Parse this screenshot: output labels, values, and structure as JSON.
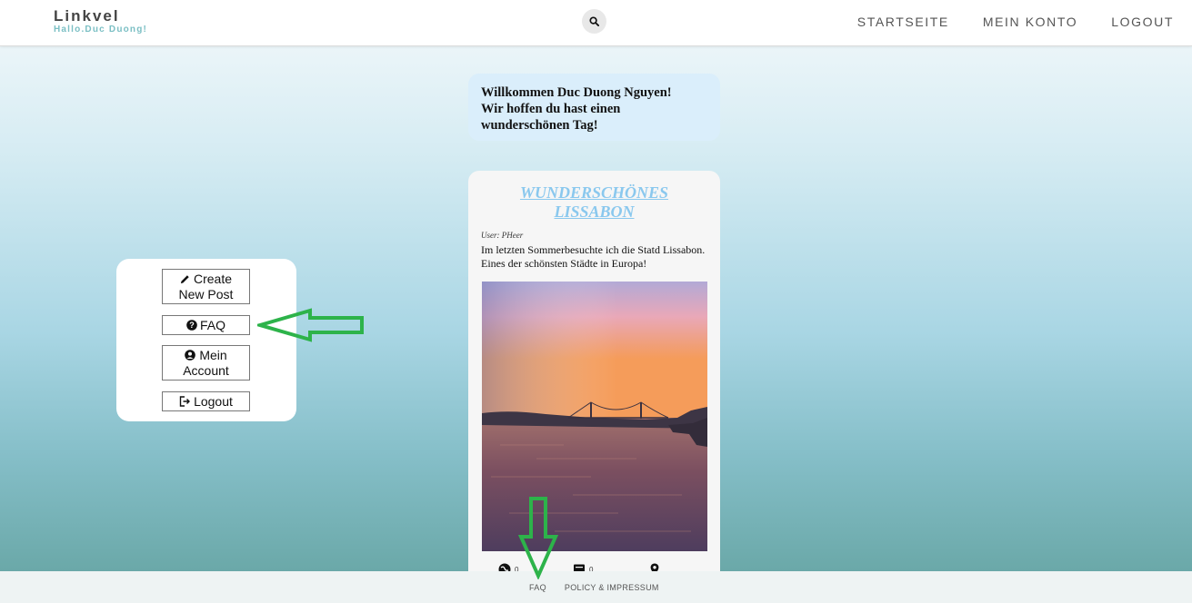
{
  "header": {
    "brand": "Linkvel",
    "greeting": "Hallo.Duc Duong!",
    "search_icon": "search-icon",
    "nav": [
      {
        "label": "STARTSEITE"
      },
      {
        "label": "MEIN KONTO"
      },
      {
        "label": "LOGOUT"
      }
    ]
  },
  "welcome": {
    "line1": "Willkommen Duc Duong Nguyen!",
    "line2": "Wir hoffen du hast einen",
    "line3": "wunderschönen Tag!"
  },
  "side_menu": {
    "items": [
      {
        "label_line1": "Create",
        "label_line2": "New Post",
        "icon": "pencil-icon"
      },
      {
        "label_line1": "FAQ",
        "icon": "question-circle-icon"
      },
      {
        "label_line1": "Mein",
        "label_line2": "Account",
        "icon": "user-circle-icon"
      },
      {
        "label_line1": "Logout",
        "icon": "logout-icon"
      }
    ]
  },
  "post": {
    "title_line1": "WUNDERSCHÖNES",
    "title_line2": "LISSABON",
    "user": "User: PHeer",
    "text": "Im letzten Sommerbesuchte ich die Statd Lissabon. Eines der schönsten Städte in Europa!",
    "actions": [
      {
        "icon": "globe-icon",
        "count": "0"
      },
      {
        "icon": "comment-icon",
        "count": "0"
      },
      {
        "icon": "location-pin-icon",
        "count": ""
      }
    ]
  },
  "footer": {
    "links": [
      {
        "label": "FAQ"
      },
      {
        "label": "POLICY & IMPRESSUM"
      }
    ]
  },
  "colors": {
    "accent_title": "#8ac8ee",
    "welcome_bg": "#daeefb",
    "annotation_arrow": "#2db34a"
  }
}
